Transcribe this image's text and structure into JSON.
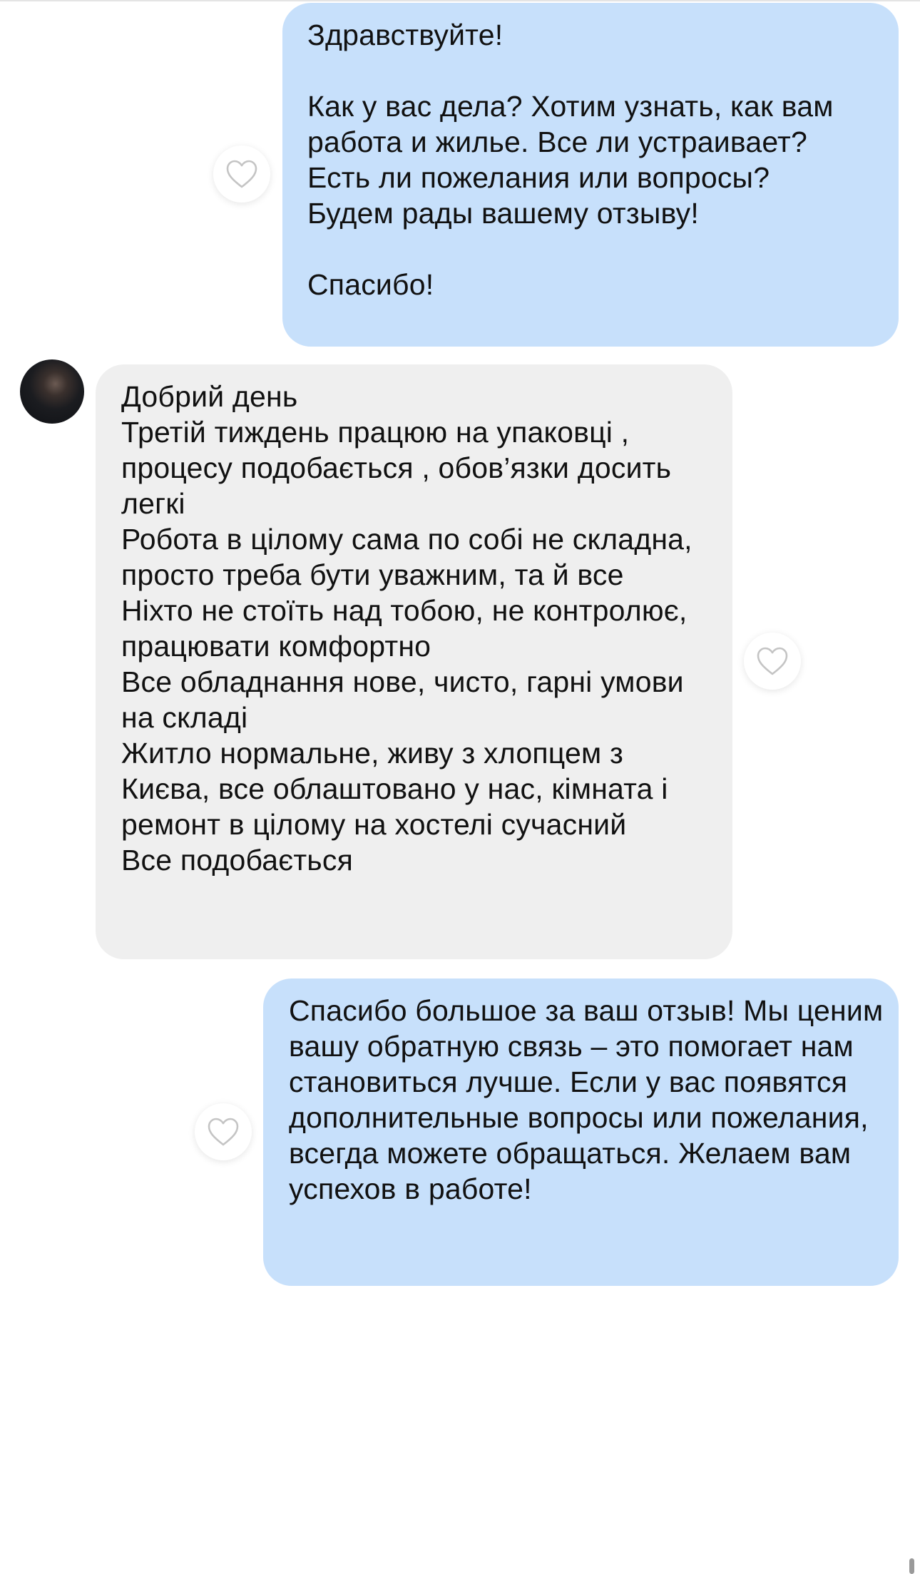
{
  "messages": [
    {
      "direction": "outgoing",
      "text": "Здравствуйте!\n\nКак у вас дела? Хотим узнать, как вам работа и жилье. Все ли устраивает? Есть ли пожелания или вопросы? Будем рады вашему отзыву!\n\nСпасибо!"
    },
    {
      "direction": "incoming",
      "text": "Добрий день\nТретій тиждень працюю на упаковці , процесу подобається , обов’язки досить легкі\nРобота в цілому сама по собі не складна, просто треба бути уважним, та й все\nНіхто не стоїть над тобою, не контролює, працювати комфортно\nВсе обладнання нове, чисто, гарні умови на складі\nЖитло нормальне, живу з хлопцем з Києва, все облаштовано у нас, кімната і ремонт в цілому на хостелі сучасний\nВсе подобається"
    },
    {
      "direction": "outgoing",
      "text": "Спасибо большое за ваш отзыв! Мы ценим вашу обратную связь – это помогает нам становиться лучше. Если у вас появятся дополнительные вопросы или пожелания, всегда можете обращаться. Желаем вам успехов в работе!"
    }
  ],
  "icons": {
    "like": "heart-outline-icon",
    "avatar": "contact-avatar"
  },
  "colors": {
    "outgoing_bubble": "#c7e0fb",
    "incoming_bubble": "#efefef",
    "like_icon": "#c4c4c4"
  }
}
